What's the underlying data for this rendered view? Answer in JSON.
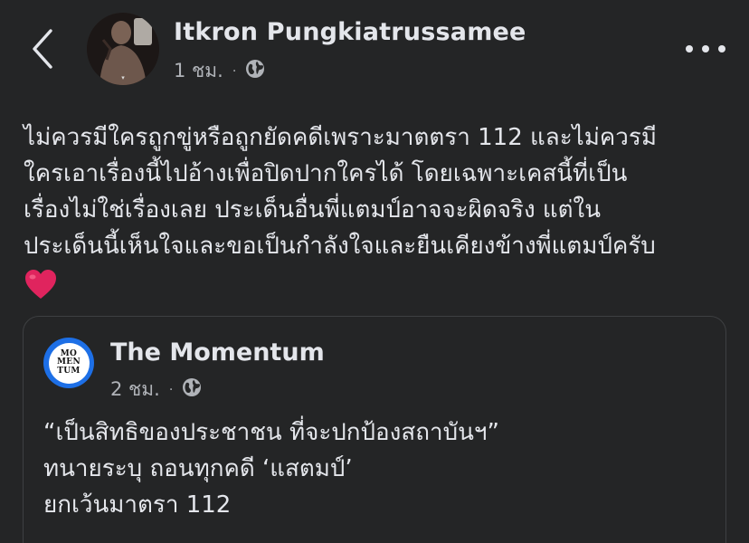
{
  "header": {
    "author_name": "Itkron Pungkiatrussamee",
    "timestamp": "1 ชม.",
    "separator": "·",
    "audience_icon": "globe-icon",
    "back_icon": "chevron-left-icon",
    "more_icon": "more-options-icon"
  },
  "post": {
    "lines": [
      "ไม่ควรมีใครถูกขู่หรือถูกยัดคดีเพราะมาตตรา 112 และไม่ควรมี",
      "ใครเอาเรื่องนี้ไปอ้างเพื่อปิดปากใครได้ โดยเฉพาะเคสนี้ที่เป็น",
      "เรื่องไม่ใช่เรื่องเลย ประเด็นอื่นพี่แตมป์อาจจะผิดจริง แต่ใน",
      "ประเด็นนี้เห็นใจและขอเป็นกำลังใจและยืนเคียงข้างพี่แตมป์ครับ"
    ],
    "emoji_icon": "red-heart-icon"
  },
  "shared_post": {
    "page_name": "The Momentum",
    "logo_text": [
      "MO",
      "MEN",
      "TUM"
    ],
    "timestamp": "2 ชม.",
    "separator": "·",
    "audience_icon": "globe-icon",
    "lines": [
      "“เป็นสิทธิของประชาชน ที่จะปกป้องสถาบันฯ”",
      "ทนายระบุ ถอนทุกคดี ‘แสตมป์’",
      "ยกเว้นมาตรา 112"
    ]
  },
  "colors": {
    "background": "#242526",
    "text_primary": "#e4e6eb",
    "text_secondary": "#b0b3b8",
    "card_border": "#3e4042",
    "logo_ring": "#1d6fe6",
    "heart": "#e0245e"
  }
}
